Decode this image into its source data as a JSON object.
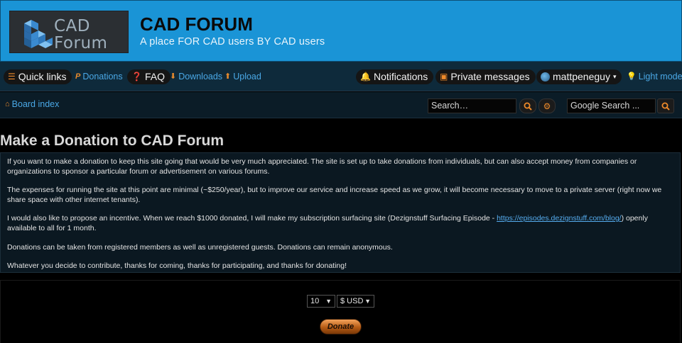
{
  "header": {
    "logo_line1": "CAD",
    "logo_line2": "Forum",
    "title": "CAD FORUM",
    "tagline": "A place FOR CAD users BY CAD users"
  },
  "nav": {
    "quick_links": "Quick links",
    "donations": "Donations",
    "faq": "FAQ",
    "downloads": "Downloads",
    "upload": "Upload",
    "notifications": "Notifications",
    "private_messages": "Private messages",
    "username": "mattpeneguy",
    "light_mode": "Light mode"
  },
  "breadcrumb": {
    "board_index": "Board index"
  },
  "search": {
    "placeholder": "Search…",
    "google_placeholder": "Google Search ..."
  },
  "main": {
    "title": "Make a Donation to CAD Forum",
    "p1": "If you want to make a donation to keep this site going that would be very much appreciated. The site is set up to take donations from individuals, but can also accept money from companies or organizations to sponsor a particular forum or advertisement on various forums.",
    "p2": "The expenses for running the site at this point are minimal (~$250/year), but to improve our service and increase speed as we grow, it will become necessary to move to a private server (right now we share space with other internet tenants).",
    "p3_before": "I would also like to propose an incentive. When we reach $1000 donated, I will make my subscription surfacing site (Dezignstuff Surfacing Episode - ",
    "p3_link": "https://episodes.dezignstuff.com/blog/",
    "p3_after": ") openly available to all for 1 month.",
    "p4": "Donations can be taken from registered members as well as unregistered guests. Donations can remain anonymous.",
    "p5": "Whatever you decide to contribute, thanks for coming, thanks for participating, and thanks for donating!"
  },
  "donation": {
    "amount": "10",
    "currency": "$ USD",
    "button": "Donate"
  },
  "colors": {
    "header_bg": "#1a94d6",
    "nav_bg": "#0e2a3b",
    "link": "#4aa8e6",
    "accent": "#f08a2a"
  },
  "icons": {
    "quick_links": "hamburger-icon",
    "donations": "paypal-icon",
    "faq": "question-circle-icon",
    "downloads": "download-icon",
    "upload": "upload-icon",
    "notifications": "bell-icon",
    "private_messages": "inbox-icon",
    "light_mode": "lightbulb-icon",
    "board_index": "home-icon",
    "search": "search-icon",
    "advanced_search": "gear-icon"
  }
}
